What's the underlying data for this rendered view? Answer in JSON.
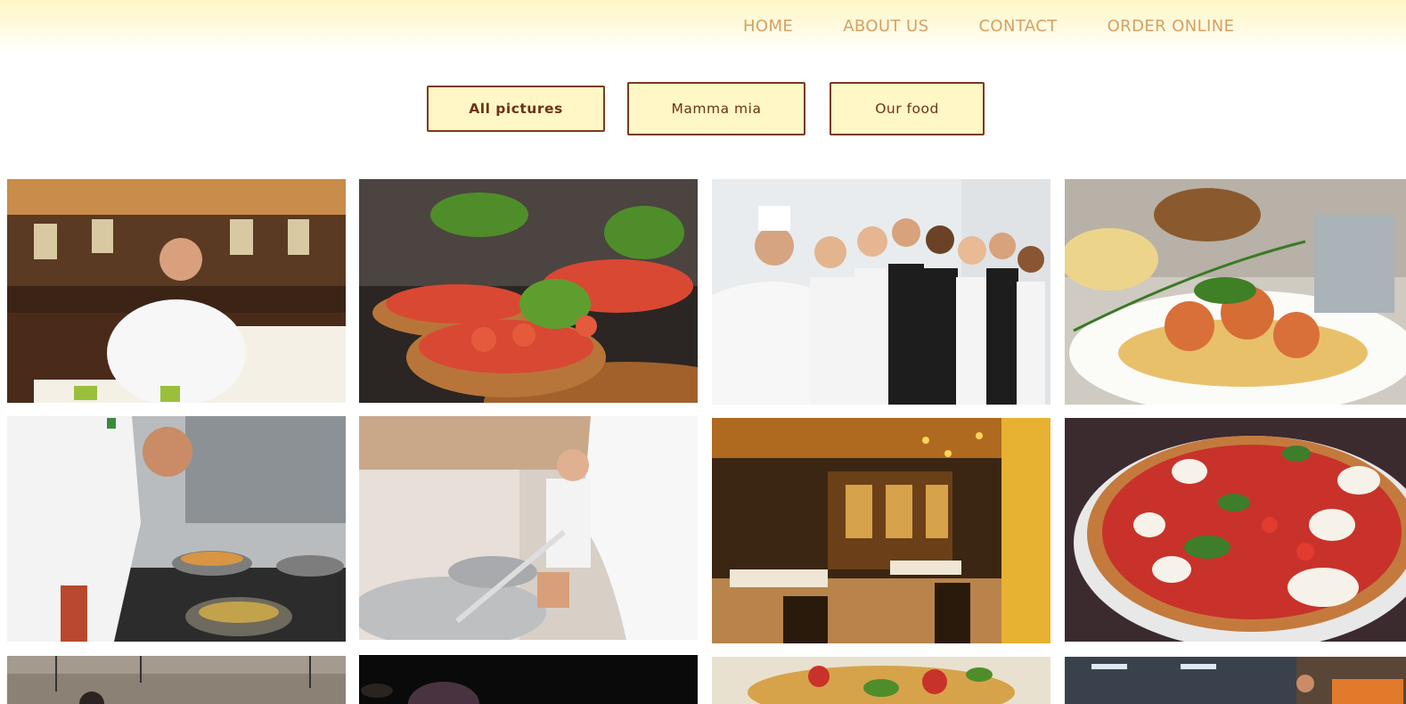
{
  "nav": {
    "items": [
      {
        "label": "HOME"
      },
      {
        "label": "ABOUT US"
      },
      {
        "label": "CONTACT"
      },
      {
        "label": "ORDER ONLINE"
      }
    ]
  },
  "filters": {
    "all": "All pictures",
    "mamma_mia": "Mamma mia",
    "our_food": "Our food"
  },
  "gallery": {
    "photos": [
      {
        "subject": "chef seated in restaurant dining room"
      },
      {
        "subject": "bruschetta with tomato and basil"
      },
      {
        "subject": "chef and waiting staff team portrait"
      },
      {
        "subject": "spaghetti with grilled shrimp"
      },
      {
        "subject": "chef cooking at stove with pans"
      },
      {
        "subject": "chef cooking with wok in kitchen"
      },
      {
        "subject": "restaurant interior with tables"
      },
      {
        "subject": "pizza with tomato, mozzarella and basil"
      },
      {
        "subject": "kitchen with hanging lamps"
      },
      {
        "subject": "dark food close-up"
      },
      {
        "subject": "plated colourful dish"
      },
      {
        "subject": "chef in open kitchen"
      }
    ]
  },
  "colors": {
    "nav_text": "#d4a164",
    "button_bg": "#fff7c6",
    "button_border": "#7b3a1c",
    "button_text": "#6e3215",
    "header_gradient_top": "#fff6c6"
  }
}
